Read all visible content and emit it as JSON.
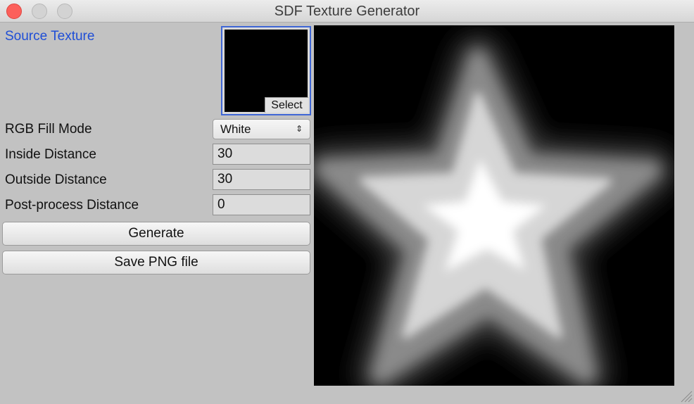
{
  "window": {
    "title": "SDF Texture Generator"
  },
  "inspector": {
    "source_texture_label": "Source Texture",
    "select_label": "Select",
    "rgb_fill_mode_label": "RGB Fill Mode",
    "rgb_fill_mode_value": "White",
    "inside_distance_label": "Inside Distance",
    "inside_distance_value": "30",
    "outside_distance_label": "Outside Distance",
    "outside_distance_value": "30",
    "post_process_label": "Post-process Distance",
    "post_process_value": "0",
    "generate_label": "Generate",
    "save_png_label": "Save PNG file"
  },
  "icons": {
    "close": "close-icon",
    "minimize": "minimize-icon",
    "maximize": "maximize-icon",
    "dropdown_arrows": "updown-arrows-icon",
    "resize_grip": "resize-grip-icon"
  },
  "colors": {
    "accent": "#1f4ed6",
    "close_button": "#fc605b",
    "preview_background": "#000000",
    "preview_glow": "#ffffff"
  }
}
